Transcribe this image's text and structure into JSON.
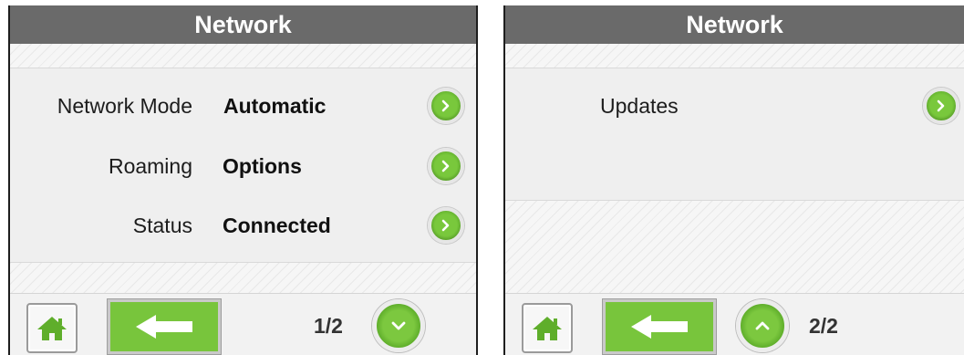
{
  "screens": [
    {
      "title": "Network",
      "rows": [
        {
          "label": "Network Mode",
          "value": "Automatic"
        },
        {
          "label": "Roaming",
          "value": "Options"
        },
        {
          "label": "Status",
          "value": "Connected"
        }
      ],
      "page_indicator": "1/2",
      "page_button_icon": "chevron-down-icon"
    },
    {
      "title": "Network",
      "rows": [
        {
          "label": "Updates",
          "value": ""
        }
      ],
      "page_indicator": "2/2",
      "page_button_icon": "chevron-up-icon"
    }
  ],
  "icons": {
    "row_action": "chevron-right-icon",
    "home": "home-icon",
    "back": "arrow-left-icon"
  },
  "colors": {
    "title_bar": "#6a6a6a",
    "accent_green": "#78c53c",
    "background": "#f0f0f0"
  }
}
